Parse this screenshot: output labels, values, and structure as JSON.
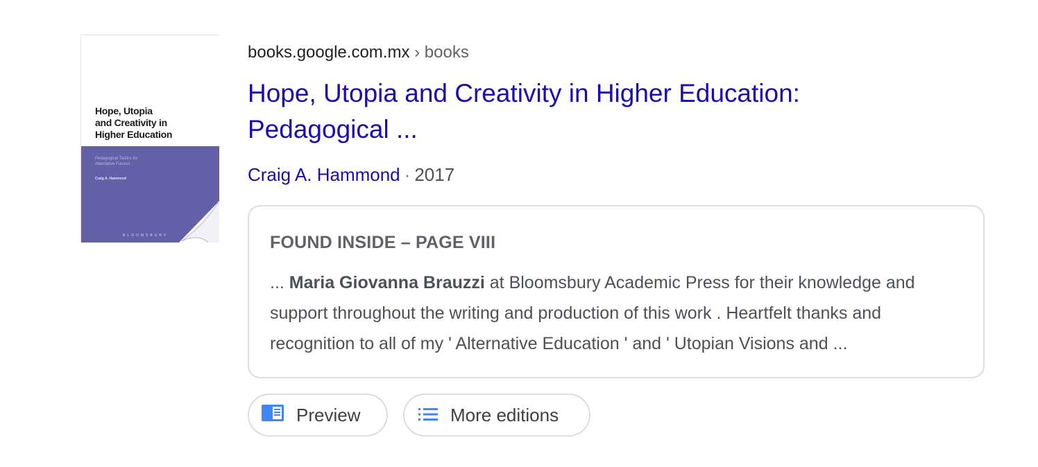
{
  "result": {
    "breadcrumb": {
      "domain": "books.google.com.mx",
      "separator": "›",
      "path": "books"
    },
    "title": "Hope, Utopia and Creativity in Higher Education: Pedagogical ...",
    "author": "Craig A. Hammond",
    "year": "2017",
    "byline_separator": "·",
    "cover": {
      "title": "Hope, Utopia\nand Creativity in\nHigher Education",
      "subtitle": "Pedagogical Tactics for\nAlternative Futures",
      "author": "Craig A. Hammond",
      "publisher": "BLOOMSBURY",
      "colors": {
        "band": "#6460a8"
      }
    },
    "found_inside": {
      "heading": "FOUND INSIDE – PAGE VIII",
      "snippet_prefix": "... ",
      "snippet_bold": "Maria Giovanna Brauzzi",
      "snippet_rest": " at Bloomsbury Academic Press for their knowledge and support throughout the writing and production of this work . Heartfelt thanks and recognition to all of my ' Alternative Education ' and ' Utopian Visions and ..."
    },
    "buttons": {
      "preview": {
        "label": "Preview",
        "icon": "book-preview-icon"
      },
      "more_editions": {
        "label": "More editions",
        "icon": "list-icon"
      }
    },
    "colors": {
      "link": "#1a0dab",
      "icon_blue": "#4285f4"
    }
  }
}
